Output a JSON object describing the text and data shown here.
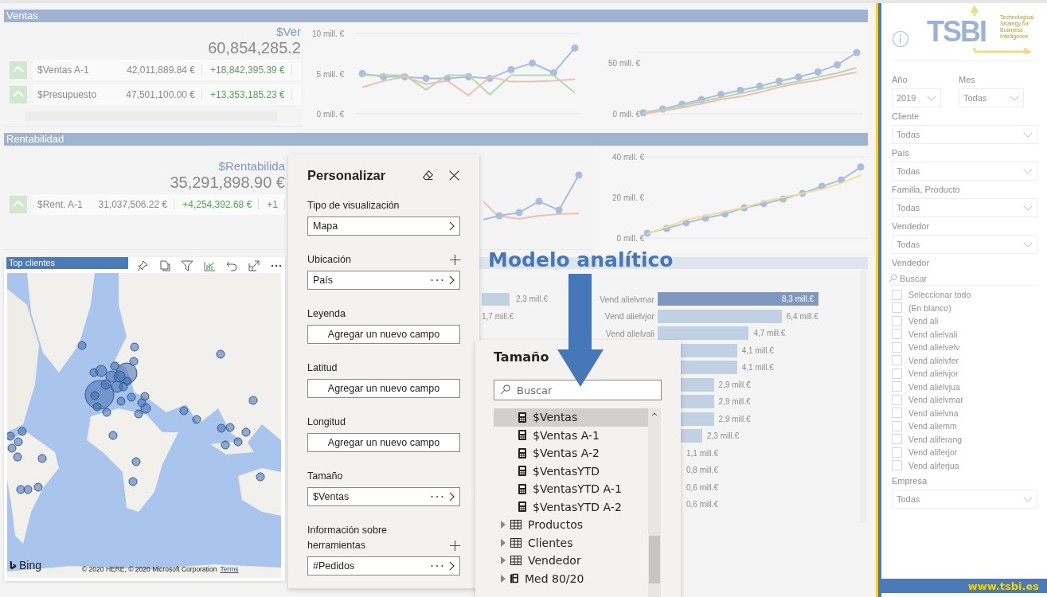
{
  "ventas": {
    "title": "Ventas",
    "kpi": {
      "label": "$Ver",
      "value": "60,854,285.2",
      "rows": [
        {
          "name": "$Ventas A-1",
          "value": "42,011,889.84 €",
          "delta": "+18,842,395.39 €"
        },
        {
          "name": "$Presupuesto",
          "value": "47,501,100.00 €",
          "delta": "+13,353,185.23 €"
        }
      ]
    },
    "chart_month": {
      "chart_data": {
        "type": "line",
        "ylim": [
          0,
          10
        ],
        "yticks": [
          {
            "value": 0,
            "label": "0 mill. €"
          },
          {
            "value": 5,
            "label": "5 mill. €"
          },
          {
            "value": 10,
            "label": "10 mill. €"
          }
        ],
        "series": [
          {
            "color": "#a9bddf",
            "marker": true,
            "values": [
              5.0,
              4.6,
              4.6,
              4.4,
              4.4,
              4.6,
              4.4,
              5.5,
              6.3,
              5.1,
              8.2
            ]
          },
          {
            "color": "#b3d9b3",
            "marker": false,
            "values": [
              4.8,
              4.8,
              4.8,
              3.0,
              4.8,
              4.8,
              2.4,
              4.8,
              4.8,
              4.8,
              2.6
            ]
          },
          {
            "color": "#eabfb4",
            "marker": false,
            "values": [
              3.3,
              4.1,
              4.6,
              3.7,
              4.1,
              2.3,
              4.6,
              4.0,
              4.0,
              4.1,
              4.3
            ]
          }
        ]
      }
    },
    "chart_ytd": {
      "chart_data": {
        "type": "line",
        "ylim": [
          0,
          60
        ],
        "yticks": [
          {
            "value": 0,
            "label": "0 mill. €"
          },
          {
            "value": 50,
            "label": "50 mill. €"
          }
        ],
        "series": [
          {
            "color": "#a9bddf",
            "marker": true,
            "values": [
              1,
              4.7,
              9.4,
              14,
              19,
              23,
              27,
              32,
              36,
              41,
              48,
              60
            ]
          },
          {
            "color": "#b3d9b3",
            "marker": false,
            "values": [
              1,
              4,
              8,
              12,
              16,
              20,
              24,
              28,
              32,
              36,
              40,
              45
            ]
          },
          {
            "color": "#eabfb4",
            "marker": false,
            "values": [
              0,
              3,
              6,
              10,
              14,
              17,
              21,
              26,
              30,
              33,
              37,
              41
            ]
          }
        ]
      }
    }
  },
  "rentabilidad": {
    "title": "Rentabilidad",
    "kpi": {
      "label": "$Rentabilida",
      "value": "35,291,898.90 €",
      "rows": [
        {
          "name": "$Rent. A-1",
          "value": "31,037,506.22 €",
          "delta": "+4,254,392.68 €",
          "extra": "+1"
        }
      ]
    },
    "chart_ytd": {
      "chart_data": {
        "type": "line",
        "ylim": [
          0,
          40
        ],
        "yticks": [
          {
            "value": 0,
            "label": "0 mill. €"
          },
          {
            "value": 20,
            "label": "20 mill. €"
          },
          {
            "value": 40,
            "label": "40 mill. €"
          }
        ],
        "series": [
          {
            "color": "#a9bddf",
            "marker": true,
            "values": [
              2.4,
              4.7,
              7.5,
              9.8,
              11.8,
              14.9,
              16.9,
              19.2,
              22,
              25.5,
              28.6,
              35
            ]
          },
          {
            "color": "#f0de9a",
            "marker": false,
            "values": [
              2,
              5.5,
              9,
              11,
              13,
              15,
              18,
              20,
              22,
              24,
              27,
              31
            ]
          }
        ]
      }
    }
  },
  "map_visual": {
    "title": "Top clientes",
    "logo_text": "Bing",
    "attribution": "© 2020 HERE, © 2020 Microsoft Corporation",
    "terms_link": "Terms"
  },
  "bar_section": {
    "left_labels": [
      "2,3 mill.€",
      "1,7 mill.€"
    ],
    "chart": {
      "chart_data": {
        "type": "bar",
        "orientation": "horizontal",
        "categories": [
          "Vend alielvmar",
          "Vend alielvjor",
          "Vend alielvali",
          null,
          null,
          null,
          null,
          null,
          null,
          null,
          null,
          null,
          null
        ],
        "values": [
          8.3,
          6.4,
          4.7,
          4.1,
          4.1,
          2.9,
          2.9,
          2.9,
          2.3,
          null,
          null,
          null,
          null
        ],
        "value_labels": [
          "8,3 mill.€",
          "6,4 mill.€",
          "4,7 mill.€",
          "4,1 mill.€",
          "4,1 mill.€",
          "2,9 mill.€",
          "2,9 mill.€",
          "2,9 mill.€",
          "2,3 mill.€",
          "1,1 mill.€",
          "0,8 mill.€",
          "0,6 mill.€",
          "0,6 mill.€"
        ]
      }
    }
  },
  "annotation": "Modelo analítico",
  "personalizar": {
    "title": "Personalizar",
    "fields": [
      {
        "label": "Tipo de visualización",
        "kind": "select",
        "value": "Mapa",
        "can_add": false,
        "open": false
      },
      {
        "label": "Ubicación",
        "kind": "field",
        "value": "País",
        "can_add": true,
        "open": false
      },
      {
        "label": "Leyenda",
        "kind": "empty",
        "value": "Agregar un nuevo campo",
        "can_add": false,
        "open": false
      },
      {
        "label": "Latitud",
        "kind": "empty",
        "value": "Agregar un nuevo campo",
        "can_add": false,
        "open": false
      },
      {
        "label": "Longitud",
        "kind": "empty",
        "value": "Agregar un nuevo campo",
        "can_add": false,
        "open": false
      },
      {
        "label": "Tamaño",
        "kind": "field",
        "value": "$Ventas",
        "can_add": false,
        "open": true
      },
      {
        "label": "Información sobre herramientas",
        "kind": "field",
        "value": "#Pedidos",
        "can_add": true,
        "open": false
      }
    ]
  },
  "field_list": {
    "title": "Tamaño",
    "search_placeholder": "Buscar",
    "items": [
      {
        "label": "$Ventas",
        "kind": "measure",
        "selected": true
      },
      {
        "label": "$Ventas A-1",
        "kind": "measure",
        "selected": false
      },
      {
        "label": "$Ventas A-2",
        "kind": "measure",
        "selected": false
      },
      {
        "label": "$VentasYTD",
        "kind": "measure",
        "selected": false
      },
      {
        "label": "$VentasYTD A-1",
        "kind": "measure",
        "selected": false
      },
      {
        "label": "$VentasYTD A-2",
        "kind": "measure",
        "selected": false
      },
      {
        "label": "Productos",
        "kind": "table",
        "selected": false
      },
      {
        "label": "Clientes",
        "kind": "table",
        "selected": false
      },
      {
        "label": "Vendedor",
        "kind": "table",
        "selected": false
      },
      {
        "label": "Med 80/20",
        "kind": "folder",
        "selected": false
      }
    ]
  },
  "filters": {
    "logo": {
      "text": "TSBI",
      "tagline": [
        "Technological",
        "Strategy for",
        "Business",
        "Intelligence"
      ]
    },
    "pair": [
      {
        "label": "Año",
        "value": "2019"
      },
      {
        "label": "Mes",
        "value": "Todas"
      }
    ],
    "selects": [
      {
        "label": "Cliente",
        "value": "Todas"
      },
      {
        "label": "País",
        "value": "Todas"
      },
      {
        "label": "Familia, Producto",
        "value": "Todas"
      },
      {
        "label": "Vendedor",
        "value": "Todas"
      }
    ],
    "list": {
      "label": "Vendedor",
      "search_placeholder": "Buscar",
      "options": [
        {
          "label": "Seleccionar todo",
          "checked": false
        },
        {
          "label": "(En blanco)",
          "checked": false
        },
        {
          "label": "Vend ali",
          "checked": false
        },
        {
          "label": "Vend alielvali",
          "checked": false
        },
        {
          "label": "Vend alielvelv",
          "checked": false
        },
        {
          "label": "Vend alielvfer",
          "checked": false
        },
        {
          "label": "Vend alielvjor",
          "checked": false
        },
        {
          "label": "Vend alielvjua",
          "checked": false
        },
        {
          "label": "Vend alielvmar",
          "checked": false
        },
        {
          "label": "Vend alielvna",
          "checked": false
        },
        {
          "label": "Vend aliemm",
          "checked": false
        },
        {
          "label": "Vend aliferang",
          "checked": false
        },
        {
          "label": "Vend aliferjor",
          "checked": false
        },
        {
          "label": "Vend aliferjua",
          "checked": false
        }
      ]
    },
    "last": {
      "label": "Empresa",
      "value": "Todas"
    },
    "footer": "www.tsbi.es"
  }
}
